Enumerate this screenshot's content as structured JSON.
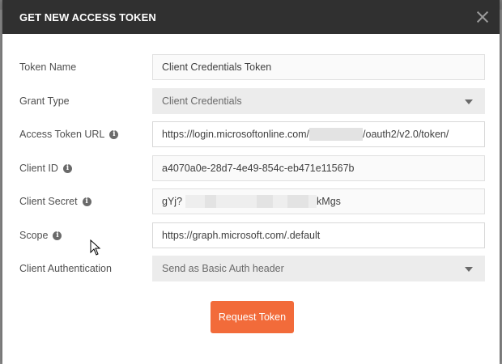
{
  "dialog": {
    "title": "GET NEW ACCESS TOKEN",
    "close_icon": "close-icon"
  },
  "fields": {
    "token_name": {
      "label": "Token Name",
      "value": "Client Credentials Token"
    },
    "grant_type": {
      "label": "Grant Type",
      "value": "Client Credentials"
    },
    "access_token_url": {
      "label": "Access Token URL",
      "value_prefix": "https://login.microsoftonline.com/",
      "value_suffix": "/oauth2/v2.0/token/"
    },
    "client_id": {
      "label": "Client ID",
      "value": "a4070a0e-28d7-4e49-854c-eb471e11567b"
    },
    "client_secret": {
      "label": "Client Secret",
      "value_prefix": "gYj?",
      "value_suffix": "kMgs"
    },
    "scope": {
      "label": "Scope",
      "value": "https://graph.microsoft.com/.default"
    },
    "client_authentication": {
      "label": "Client Authentication",
      "value": "Send as Basic Auth header"
    }
  },
  "actions": {
    "request_token_label": "Request Token"
  },
  "colors": {
    "header_bg": "#303030",
    "accent": "#f26b3a"
  }
}
